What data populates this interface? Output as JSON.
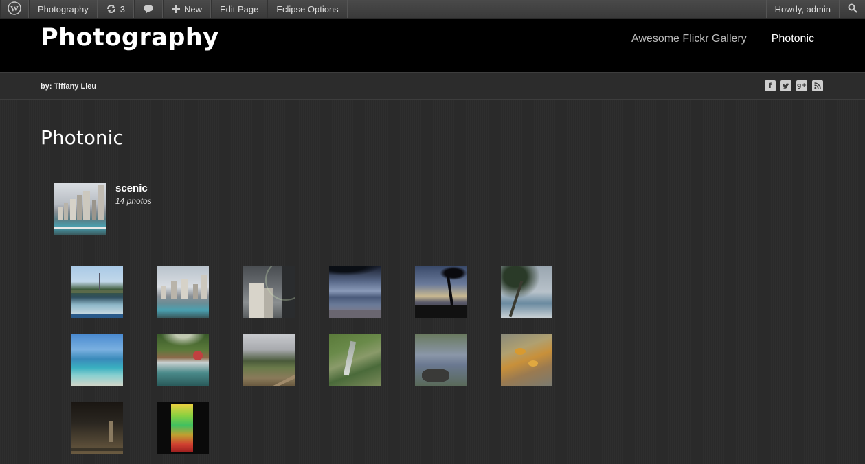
{
  "adminbar": {
    "site_name": "Photography",
    "updates_count": "3",
    "new_label": "New",
    "edit_page_label": "Edit Page",
    "eclipse_options_label": "Eclipse Options",
    "greeting": "Howdy, admin"
  },
  "header": {
    "site_title": "Photography",
    "nav": [
      {
        "label": "Awesome Flickr Gallery"
      },
      {
        "label": "Photonic"
      }
    ]
  },
  "byline": "by: Tiffany Lieu",
  "social_icons": [
    "facebook-icon",
    "twitter-icon",
    "google-plus-icon",
    "rss-icon"
  ],
  "page": {
    "title": "Photonic"
  },
  "album": {
    "name": "scenic",
    "count": "14 photos"
  },
  "photos": [
    {
      "name": "photo-bridge-pool"
    },
    {
      "name": "photo-city-lagoon"
    },
    {
      "name": "photo-rainbow-hotel"
    },
    {
      "name": "photo-beach-dusk"
    },
    {
      "name": "photo-palm-sunset"
    },
    {
      "name": "photo-palm-tree"
    },
    {
      "name": "photo-turquoise-sea"
    },
    {
      "name": "photo-waterfall-garden"
    },
    {
      "name": "photo-mountain-trail"
    },
    {
      "name": "photo-stream-grass"
    },
    {
      "name": "photo-lavender-rocks"
    },
    {
      "name": "photo-autumn-leaves"
    },
    {
      "name": "photo-night-street"
    },
    {
      "name": "photo-neon-building"
    }
  ],
  "colors": {
    "background": "#2a2a2a",
    "header": "#000000",
    "adminbar": "#464646",
    "nav_active": "#ffffff",
    "nav_inactive": "#bbbbbb"
  }
}
